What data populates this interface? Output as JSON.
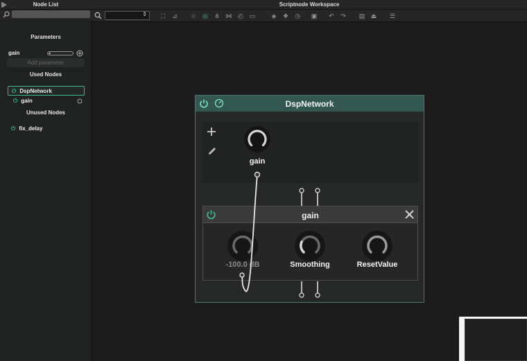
{
  "window": {
    "left_title": "Node List",
    "right_title": "Scriptnode Workspace"
  },
  "sidebar": {
    "search_placeholder": "",
    "parameters_title": "Parameters",
    "parameter": {
      "name": "gain"
    },
    "add_parameter_label": "Add parameter",
    "used_nodes_title": "Used Nodes",
    "used_nodes": [
      "DspNetwork",
      "gain"
    ],
    "unused_nodes_title": "Unused Nodes",
    "unused_nodes": [
      "fix_delay"
    ]
  },
  "toolbar": {
    "selected_value": "",
    "icons": [
      "zoom-fit-icon",
      "chart-icon",
      "bypass-icon",
      "active-icon",
      "split-icon",
      "hierarchy-icon",
      "history-icon",
      "comment-icon",
      "cube-icon",
      "cubes-icon",
      "clock-icon",
      "lock-icon",
      "undo-icon",
      "redo-icon",
      "save-icon",
      "eject-icon",
      "properties-icon"
    ]
  },
  "network": {
    "title": "DspNetwork",
    "parameter_knob_label": "gain"
  },
  "gain_node": {
    "title": "gain",
    "knobs": [
      {
        "label": "-100.0 dB",
        "value": 0.0
      },
      {
        "label": "Smoothing",
        "value": 0.1
      },
      {
        "label": "ResetValue",
        "value": 0.0
      }
    ]
  },
  "colors": {
    "accent": "#3fb88c",
    "network_header": "#325751",
    "network_border": "#4b7b70"
  }
}
